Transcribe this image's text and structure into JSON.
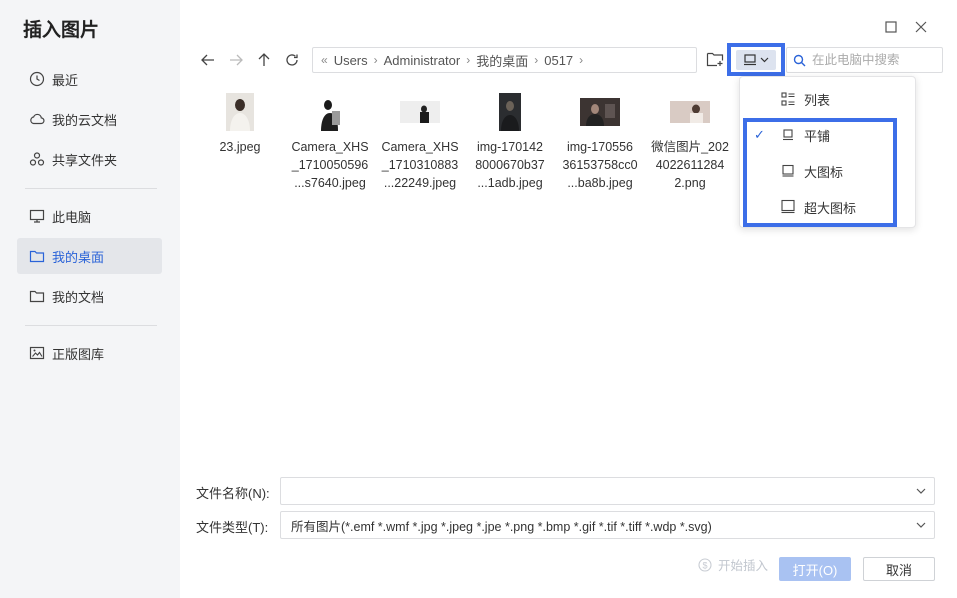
{
  "dialog": {
    "title": "插入图片"
  },
  "sidebar": {
    "items": [
      {
        "label": "最近",
        "icon": "clock-icon"
      },
      {
        "label": "我的云文档",
        "icon": "cloud-icon"
      },
      {
        "label": "共享文件夹",
        "icon": "share-icon"
      },
      {
        "label": "此电脑",
        "icon": "computer-icon"
      },
      {
        "label": "我的桌面",
        "icon": "folder-icon",
        "active": true
      },
      {
        "label": "我的文档",
        "icon": "folder-icon"
      },
      {
        "label": "正版图库",
        "icon": "image-gallery-icon"
      }
    ]
  },
  "pathbar": {
    "crumbs": [
      "Users",
      "Administrator",
      "我的桌面",
      "0517"
    ]
  },
  "search": {
    "placeholder": "在此电脑中搜索"
  },
  "files": [
    {
      "lines": [
        "23.jpeg"
      ]
    },
    {
      "lines": [
        "Camera_XHS",
        "_1710050596",
        "...s7640.jpeg"
      ]
    },
    {
      "lines": [
        "Camera_XHS",
        "_1710310883",
        "...22249.jpeg"
      ]
    },
    {
      "lines": [
        "img-170142",
        "8000670b37",
        "...1adb.jpeg"
      ]
    },
    {
      "lines": [
        "img-170556",
        "36153758cc0",
        "...ba8b.jpeg"
      ]
    },
    {
      "lines": [
        "微信图片_202",
        "4022611284",
        "2.png"
      ]
    }
  ],
  "view_menu": {
    "items": [
      {
        "label": "列表",
        "icon": "list-view-icon",
        "checked": false
      },
      {
        "label": "平铺",
        "icon": "tile-view-icon",
        "checked": true
      },
      {
        "label": "大图标",
        "icon": "large-icon-view-icon",
        "checked": false
      },
      {
        "label": "超大图标",
        "icon": "extra-large-icon-view-icon",
        "checked": false
      }
    ],
    "check_mark": "✓"
  },
  "form": {
    "filename_label": "文件名称(N):",
    "filename_value": "",
    "filetype_label": "文件类型(T):",
    "filetype_value": "所有图片(*.emf *.wmf *.jpg *.jpeg *.jpe *.png *.bmp *.gif *.tif *.tiff *.wdp *.svg)"
  },
  "buttons": {
    "start_insert": "开始插入",
    "open": "打开(O)",
    "cancel": "取消"
  },
  "colors": {
    "accent": "#2a63d8",
    "highlight_border": "#3c6ee8",
    "sidebar_bg": "#f4f5f7",
    "open_button_bg": "#a9c2f2"
  }
}
